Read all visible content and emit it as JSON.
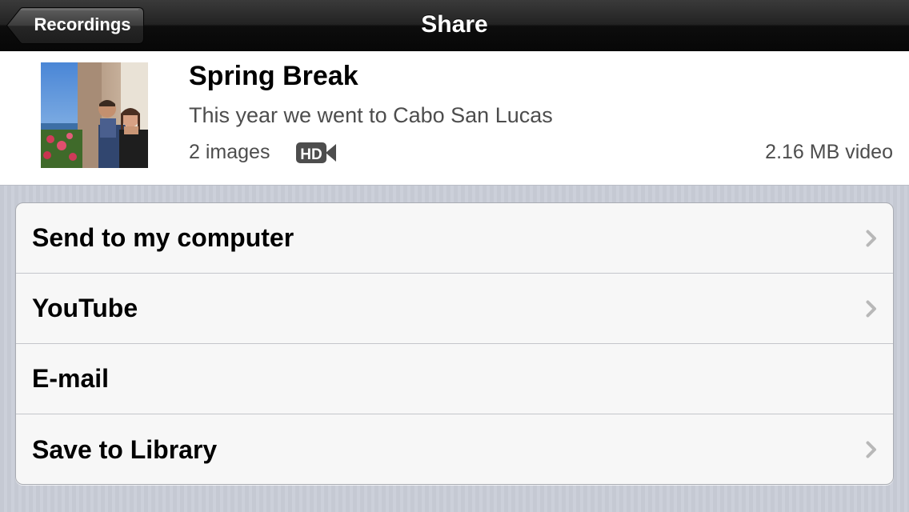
{
  "navbar": {
    "back_label": "Recordings",
    "title": "Share"
  },
  "recording": {
    "title": "Spring Break",
    "description": "This year we went to Cabo San Lucas",
    "images": "2 images",
    "hd_badge": "HD",
    "size": "2.16 MB video"
  },
  "share_options": [
    {
      "label": "Send to my computer",
      "has_chevron": true
    },
    {
      "label": "YouTube",
      "has_chevron": true
    },
    {
      "label": "E-mail",
      "has_chevron": false
    },
    {
      "label": "Save to Library",
      "has_chevron": true
    }
  ],
  "colors": {
    "navbar": "#0d0d0d",
    "background": "#c8ccd6",
    "chevron": "#b8b8b8"
  }
}
